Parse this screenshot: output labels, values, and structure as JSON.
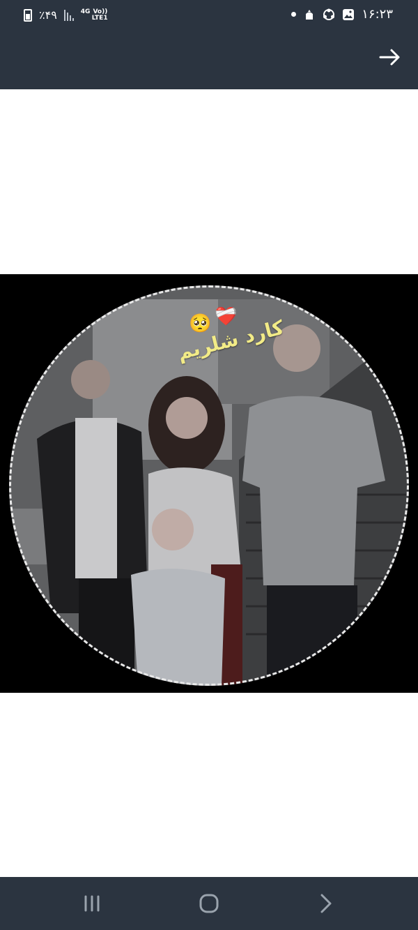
{
  "status_bar": {
    "battery_text": "٪۴۹",
    "network_gen": "4G",
    "network_volte": "Vo))",
    "network_lte": "LTE1",
    "time": "۱۶:۲۳"
  },
  "photo": {
    "caption": "کارد شلریم",
    "emoji_face": "🥺",
    "emoji_heart": "❤️‍🩹"
  },
  "colors": {
    "bar_background": "#2b3440",
    "caption_color": "#f2eb87"
  },
  "icons": {
    "back": "arrow-right-icon",
    "recents": "recent-apps-icon",
    "home": "home-icon",
    "nav_back": "chevron-right-icon"
  }
}
